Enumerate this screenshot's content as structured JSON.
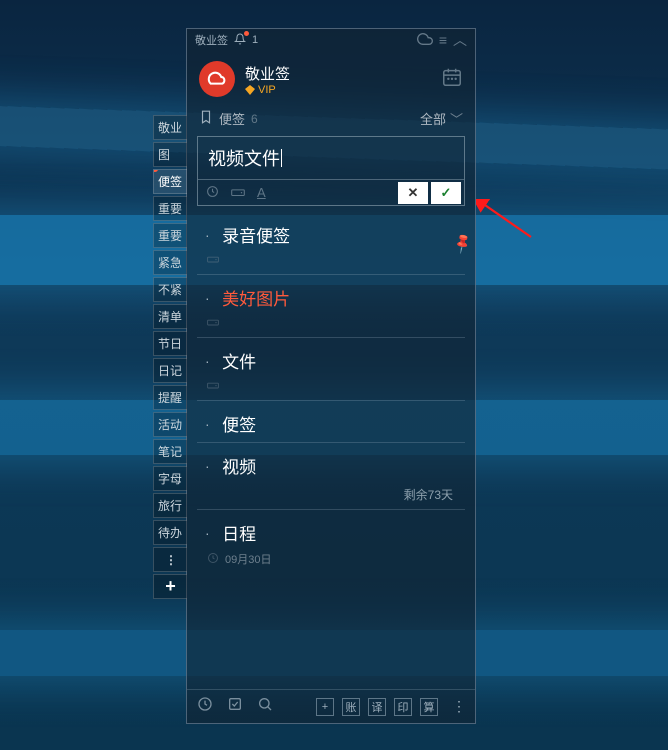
{
  "titlebar": {
    "app_name": "敬业签",
    "bell_count": "1"
  },
  "header": {
    "brand": "敬业签",
    "vip": "VIP"
  },
  "listhdr": {
    "icon_label": "便签",
    "label": "便签",
    "count": "6",
    "filter": "全部"
  },
  "editor": {
    "text": "视频文件"
  },
  "side_tabs": [
    "敬业",
    "图",
    "便签",
    "重要",
    "重要",
    "紧急",
    "不紧",
    "清单",
    "节日",
    "日记",
    "提醒",
    "活动",
    "笔记",
    "字母",
    "旅行",
    "待办"
  ],
  "notes": [
    {
      "title": "录音便签",
      "date": ""
    },
    {
      "title": "美好图片",
      "red": true
    },
    {
      "title": "文件"
    },
    {
      "title": "便签"
    },
    {
      "title": "视频",
      "remain": "剩余73天"
    },
    {
      "title": "日程",
      "date": "09月30日"
    }
  ],
  "footer": {
    "btn1": "账",
    "btn2": "译",
    "btn3": "印",
    "btn4": "算"
  }
}
